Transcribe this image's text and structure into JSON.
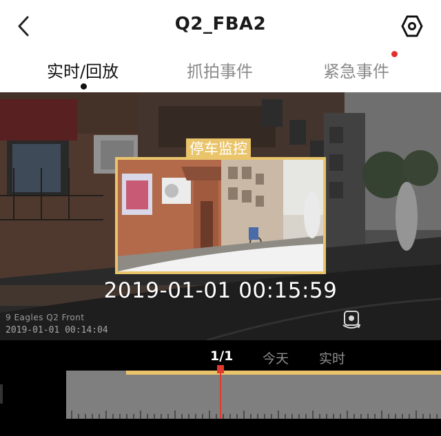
{
  "header": {
    "title": "Q2_FBA2",
    "back_icon": "chevron-left-icon",
    "settings_icon": "hexagon-settings-icon"
  },
  "tabs": [
    {
      "label": "实时/回放",
      "active": true
    },
    {
      "label": "抓拍事件",
      "active": false
    },
    {
      "label": "紧急事件",
      "active": false,
      "badge": true
    }
  ],
  "video": {
    "watermark_brand": "9 Eagles Q2 Front",
    "watermark_time": "2019-01-01 00:14:04",
    "event": {
      "label": "停车监控",
      "time": "2019-01-01 00:15:59"
    },
    "camera_switch_icon": "camera-rotate-icon"
  },
  "timeline": {
    "page": "1/1",
    "today_label": "今天",
    "live_label": "实时"
  },
  "colors": {
    "accent": "#e9c46a",
    "badge": "#e0312c",
    "playhead": "#e3382f"
  }
}
